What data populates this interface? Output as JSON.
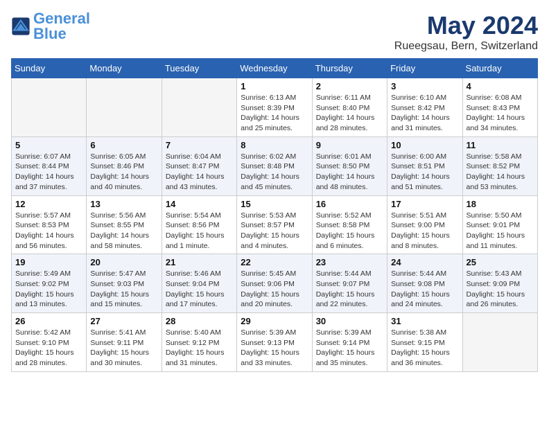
{
  "header": {
    "logo_general": "General",
    "logo_blue": "Blue",
    "month_title": "May 2024",
    "location": "Rueegsau, Bern, Switzerland"
  },
  "days_of_week": [
    "Sunday",
    "Monday",
    "Tuesday",
    "Wednesday",
    "Thursday",
    "Friday",
    "Saturday"
  ],
  "weeks": [
    [
      {
        "day": "",
        "info": ""
      },
      {
        "day": "",
        "info": ""
      },
      {
        "day": "",
        "info": ""
      },
      {
        "day": "1",
        "info": "Sunrise: 6:13 AM\nSunset: 8:39 PM\nDaylight: 14 hours\nand 25 minutes."
      },
      {
        "day": "2",
        "info": "Sunrise: 6:11 AM\nSunset: 8:40 PM\nDaylight: 14 hours\nand 28 minutes."
      },
      {
        "day": "3",
        "info": "Sunrise: 6:10 AM\nSunset: 8:42 PM\nDaylight: 14 hours\nand 31 minutes."
      },
      {
        "day": "4",
        "info": "Sunrise: 6:08 AM\nSunset: 8:43 PM\nDaylight: 14 hours\nand 34 minutes."
      }
    ],
    [
      {
        "day": "5",
        "info": "Sunrise: 6:07 AM\nSunset: 8:44 PM\nDaylight: 14 hours\nand 37 minutes."
      },
      {
        "day": "6",
        "info": "Sunrise: 6:05 AM\nSunset: 8:46 PM\nDaylight: 14 hours\nand 40 minutes."
      },
      {
        "day": "7",
        "info": "Sunrise: 6:04 AM\nSunset: 8:47 PM\nDaylight: 14 hours\nand 43 minutes."
      },
      {
        "day": "8",
        "info": "Sunrise: 6:02 AM\nSunset: 8:48 PM\nDaylight: 14 hours\nand 45 minutes."
      },
      {
        "day": "9",
        "info": "Sunrise: 6:01 AM\nSunset: 8:50 PM\nDaylight: 14 hours\nand 48 minutes."
      },
      {
        "day": "10",
        "info": "Sunrise: 6:00 AM\nSunset: 8:51 PM\nDaylight: 14 hours\nand 51 minutes."
      },
      {
        "day": "11",
        "info": "Sunrise: 5:58 AM\nSunset: 8:52 PM\nDaylight: 14 hours\nand 53 minutes."
      }
    ],
    [
      {
        "day": "12",
        "info": "Sunrise: 5:57 AM\nSunset: 8:53 PM\nDaylight: 14 hours\nand 56 minutes."
      },
      {
        "day": "13",
        "info": "Sunrise: 5:56 AM\nSunset: 8:55 PM\nDaylight: 14 hours\nand 58 minutes."
      },
      {
        "day": "14",
        "info": "Sunrise: 5:54 AM\nSunset: 8:56 PM\nDaylight: 15 hours\nand 1 minute."
      },
      {
        "day": "15",
        "info": "Sunrise: 5:53 AM\nSunset: 8:57 PM\nDaylight: 15 hours\nand 4 minutes."
      },
      {
        "day": "16",
        "info": "Sunrise: 5:52 AM\nSunset: 8:58 PM\nDaylight: 15 hours\nand 6 minutes."
      },
      {
        "day": "17",
        "info": "Sunrise: 5:51 AM\nSunset: 9:00 PM\nDaylight: 15 hours\nand 8 minutes."
      },
      {
        "day": "18",
        "info": "Sunrise: 5:50 AM\nSunset: 9:01 PM\nDaylight: 15 hours\nand 11 minutes."
      }
    ],
    [
      {
        "day": "19",
        "info": "Sunrise: 5:49 AM\nSunset: 9:02 PM\nDaylight: 15 hours\nand 13 minutes."
      },
      {
        "day": "20",
        "info": "Sunrise: 5:47 AM\nSunset: 9:03 PM\nDaylight: 15 hours\nand 15 minutes."
      },
      {
        "day": "21",
        "info": "Sunrise: 5:46 AM\nSunset: 9:04 PM\nDaylight: 15 hours\nand 17 minutes."
      },
      {
        "day": "22",
        "info": "Sunrise: 5:45 AM\nSunset: 9:06 PM\nDaylight: 15 hours\nand 20 minutes."
      },
      {
        "day": "23",
        "info": "Sunrise: 5:44 AM\nSunset: 9:07 PM\nDaylight: 15 hours\nand 22 minutes."
      },
      {
        "day": "24",
        "info": "Sunrise: 5:44 AM\nSunset: 9:08 PM\nDaylight: 15 hours\nand 24 minutes."
      },
      {
        "day": "25",
        "info": "Sunrise: 5:43 AM\nSunset: 9:09 PM\nDaylight: 15 hours\nand 26 minutes."
      }
    ],
    [
      {
        "day": "26",
        "info": "Sunrise: 5:42 AM\nSunset: 9:10 PM\nDaylight: 15 hours\nand 28 minutes."
      },
      {
        "day": "27",
        "info": "Sunrise: 5:41 AM\nSunset: 9:11 PM\nDaylight: 15 hours\nand 30 minutes."
      },
      {
        "day": "28",
        "info": "Sunrise: 5:40 AM\nSunset: 9:12 PM\nDaylight: 15 hours\nand 31 minutes."
      },
      {
        "day": "29",
        "info": "Sunrise: 5:39 AM\nSunset: 9:13 PM\nDaylight: 15 hours\nand 33 minutes."
      },
      {
        "day": "30",
        "info": "Sunrise: 5:39 AM\nSunset: 9:14 PM\nDaylight: 15 hours\nand 35 minutes."
      },
      {
        "day": "31",
        "info": "Sunrise: 5:38 AM\nSunset: 9:15 PM\nDaylight: 15 hours\nand 36 minutes."
      },
      {
        "day": "",
        "info": ""
      }
    ]
  ]
}
